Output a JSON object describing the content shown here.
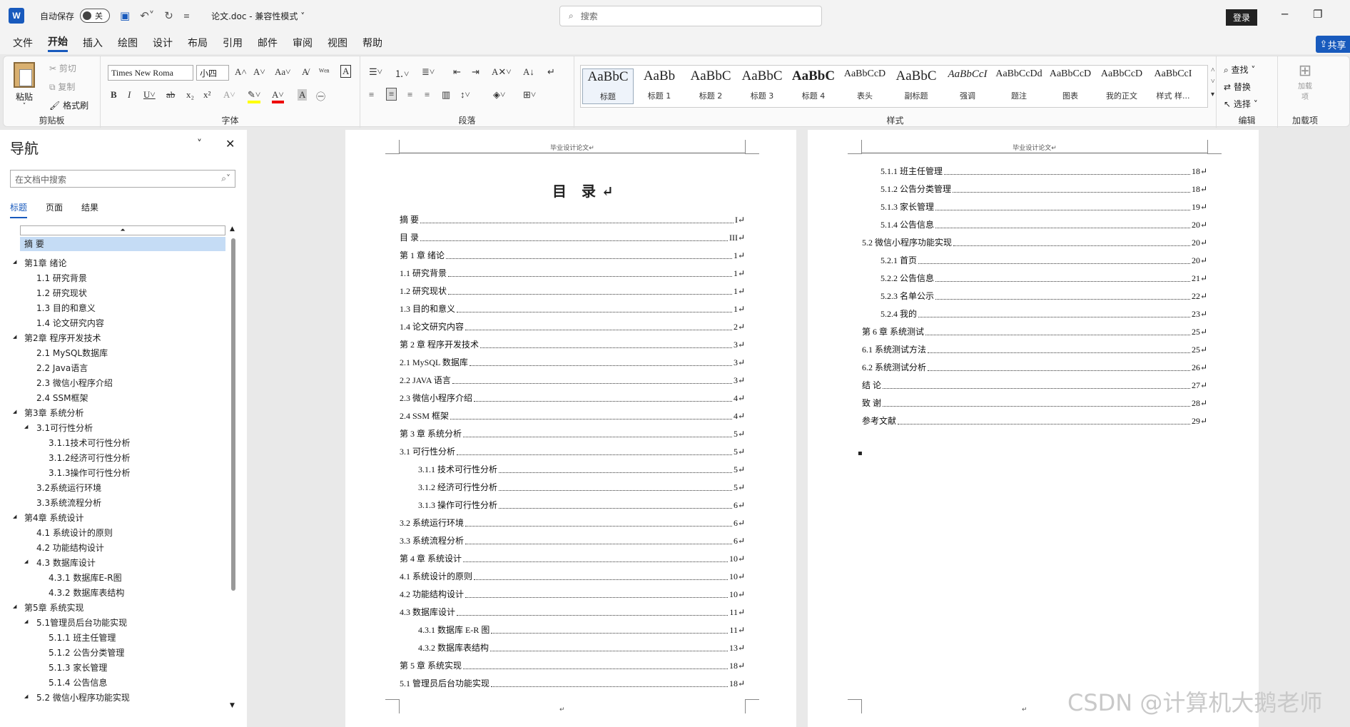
{
  "titlebar": {
    "logo": "W",
    "autosave_label": "自动保存",
    "autosave_state": "关",
    "doc_title": "论文.doc",
    "compat": "兼容性模式",
    "search_placeholder": "搜索",
    "login": "登录"
  },
  "tabs": [
    "文件",
    "开始",
    "插入",
    "绘图",
    "设计",
    "布局",
    "引用",
    "邮件",
    "审阅",
    "视图",
    "帮助"
  ],
  "share": "共享",
  "ribbon": {
    "clipboard": {
      "paste": "粘贴",
      "cut": "剪切",
      "copy": "复制",
      "format_painter": "格式刷",
      "label": "剪贴板"
    },
    "font": {
      "name": "Times New Roma",
      "size": "小四",
      "label": "字体"
    },
    "paragraph": {
      "label": "段落"
    },
    "styles": {
      "label": "样式",
      "items": [
        {
          "preview": "AaBbC",
          "name": "标题"
        },
        {
          "preview": "AaBb",
          "name": "标题 1"
        },
        {
          "preview": "AaBbC",
          "name": "标题 2"
        },
        {
          "preview": "AaBbC",
          "name": "标题 3"
        },
        {
          "preview": "AaBbC",
          "name": "标题 4"
        },
        {
          "preview": "AaBbCcD",
          "name": "表头"
        },
        {
          "preview": "AaBbC",
          "name": "副标题"
        },
        {
          "preview": "AaBbCcI",
          "name": "强调"
        },
        {
          "preview": "AaBbCcDd",
          "name": "题注"
        },
        {
          "preview": "AaBbCcD",
          "name": "图表"
        },
        {
          "preview": "AaBbCcD",
          "name": "我的正文"
        },
        {
          "preview": "AaBbCcI",
          "name": "样式 样..."
        }
      ]
    },
    "editing": {
      "find": "查找",
      "replace": "替换",
      "select": "选择",
      "label": "编辑"
    },
    "addins": {
      "label": "加载项",
      "btn": "加载项"
    }
  },
  "nav": {
    "title": "导航",
    "search_placeholder": "在文档中搜索",
    "tabs": [
      "标题",
      "页面",
      "结果"
    ],
    "items": [
      {
        "text": "摘  要",
        "level": 0,
        "sel": true
      },
      {
        "text": "第1章 绪论",
        "level": 0,
        "exp": true
      },
      {
        "text": "1.1 研究背景",
        "level": 1
      },
      {
        "text": "1.2 研究现状",
        "level": 1
      },
      {
        "text": "1.3 目的和意义",
        "level": 1
      },
      {
        "text": "1.4 论文研究内容",
        "level": 1
      },
      {
        "text": "第2章 程序开发技术",
        "level": 0,
        "exp": true
      },
      {
        "text": "2.1 MySQL数据库",
        "level": 1
      },
      {
        "text": "2.2 Java语言",
        "level": 1
      },
      {
        "text": "2.3 微信小程序介绍",
        "level": 1
      },
      {
        "text": "2.4 SSM框架",
        "level": 1
      },
      {
        "text": "第3章 系统分析",
        "level": 0,
        "exp": true
      },
      {
        "text": "3.1可行性分析",
        "level": 1,
        "exp": true
      },
      {
        "text": "3.1.1技术可行性分析",
        "level": 2
      },
      {
        "text": "3.1.2经济可行性分析",
        "level": 2
      },
      {
        "text": "3.1.3操作可行性分析",
        "level": 2
      },
      {
        "text": "3.2系统运行环境",
        "level": 1
      },
      {
        "text": "3.3系统流程分析",
        "level": 1
      },
      {
        "text": "第4章 系统设计",
        "level": 0,
        "exp": true
      },
      {
        "text": "4.1 系统设计的原则",
        "level": 1
      },
      {
        "text": "4.2 功能结构设计",
        "level": 1
      },
      {
        "text": "4.3 数据库设计",
        "level": 1,
        "exp": true
      },
      {
        "text": "4.3.1 数据库E-R图",
        "level": 2
      },
      {
        "text": "4.3.2 数据库表结构",
        "level": 2
      },
      {
        "text": "第5章 系统实现",
        "level": 0,
        "exp": true
      },
      {
        "text": "5.1管理员后台功能实现",
        "level": 1,
        "exp": true
      },
      {
        "text": "5.1.1 班主任管理",
        "level": 2
      },
      {
        "text": "5.1.2 公告分类管理",
        "level": 2
      },
      {
        "text": "5.1.3 家长管理",
        "level": 2
      },
      {
        "text": "5.1.4 公告信息",
        "level": 2
      },
      {
        "text": "5.2 微信小程序功能实现",
        "level": 1,
        "exp": true
      }
    ]
  },
  "page1": {
    "header": "毕业设计论文↵",
    "toc_title": "目  录↵",
    "entries": [
      {
        "t": "摘    要",
        "p": "I↵",
        "l": 0
      },
      {
        "t": "目    录",
        "p": "III↵",
        "l": 0
      },
      {
        "t": "第 1 章  绪论",
        "p": "1↵",
        "l": 0
      },
      {
        "t": "1.1 研究背景",
        "p": "1↵",
        "l": 0
      },
      {
        "t": "1.2 研究现状",
        "p": "1↵",
        "l": 0
      },
      {
        "t": "1.3 目的和意义",
        "p": "1↵",
        "l": 0
      },
      {
        "t": "1.4 论文研究内容",
        "p": "2↵",
        "l": 0
      },
      {
        "t": "第 2 章  程序开发技术",
        "p": "3↵",
        "l": 0
      },
      {
        "t": "2.1 MySQL 数据库",
        "p": "3↵",
        "l": 0
      },
      {
        "t": "2.2 JAVA 语言",
        "p": "3↵",
        "l": 0
      },
      {
        "t": "2.3 微信小程序介绍",
        "p": "4↵",
        "l": 0
      },
      {
        "t": "2.4 SSM 框架",
        "p": "4↵",
        "l": 0
      },
      {
        "t": "第 3 章  系统分析",
        "p": "5↵",
        "l": 0
      },
      {
        "t": "3.1 可行性分析",
        "p": "5↵",
        "l": 0
      },
      {
        "t": "3.1.1 技术可行性分析",
        "p": "5↵",
        "l": 1
      },
      {
        "t": "3.1.2 经济可行性分析",
        "p": "5↵",
        "l": 1
      },
      {
        "t": "3.1.3 操作可行性分析",
        "p": "6↵",
        "l": 1
      },
      {
        "t": "3.2 系统运行环境",
        "p": "6↵",
        "l": 0
      },
      {
        "t": "3.3 系统流程分析",
        "p": "6↵",
        "l": 0
      },
      {
        "t": "第 4 章  系统设计",
        "p": "10↵",
        "l": 0
      },
      {
        "t": "4.1 系统设计的原则",
        "p": "10↵",
        "l": 0
      },
      {
        "t": "4.2 功能结构设计",
        "p": "10↵",
        "l": 0
      },
      {
        "t": "4.3 数据库设计",
        "p": "11↵",
        "l": 0
      },
      {
        "t": "4.3.1  数据库 E-R 图",
        "p": "11↵",
        "l": 1
      },
      {
        "t": "4.3.2  数据库表结构",
        "p": "13↵",
        "l": 1
      },
      {
        "t": "第 5 章  系统实现",
        "p": "18↵",
        "l": 0
      },
      {
        "t": "5.1 管理员后台功能实现",
        "p": "18↵",
        "l": 0
      }
    ],
    "footer": "↵"
  },
  "page2": {
    "header": "毕业设计论文↵",
    "entries": [
      {
        "t": "5.1.1  班主任管理",
        "p": "18↵",
        "l": 1
      },
      {
        "t": "5.1.2  公告分类管理",
        "p": "18↵",
        "l": 1
      },
      {
        "t": "5.1.3  家长管理",
        "p": "19↵",
        "l": 1
      },
      {
        "t": "5.1.4  公告信息",
        "p": "20↵",
        "l": 1
      },
      {
        "t": "5.2  微信小程序功能实现",
        "p": "20↵",
        "l": 0
      },
      {
        "t": "5.2.1  首页",
        "p": "20↵",
        "l": 1
      },
      {
        "t": "5.2.2  公告信息",
        "p": "21↵",
        "l": 1
      },
      {
        "t": "5.2.3  名单公示",
        "p": "22↵",
        "l": 1
      },
      {
        "t": "5.2.4  我的",
        "p": "23↵",
        "l": 1
      },
      {
        "t": "第 6 章  系统测试",
        "p": "25↵",
        "l": 0
      },
      {
        "t": "6.1 系统测试方法",
        "p": "25↵",
        "l": 0
      },
      {
        "t": "6.2 系统测试分析",
        "p": "26↵",
        "l": 0
      },
      {
        "t": "结    论",
        "p": "27↵",
        "l": 0
      },
      {
        "t": "致    谢",
        "p": "28↵",
        "l": 0
      },
      {
        "t": "参考文献",
        "p": "29↵",
        "l": 0
      }
    ],
    "bullet": "▪",
    "footer": "↵"
  },
  "watermark": "CSDN @计算机大鹅老师"
}
